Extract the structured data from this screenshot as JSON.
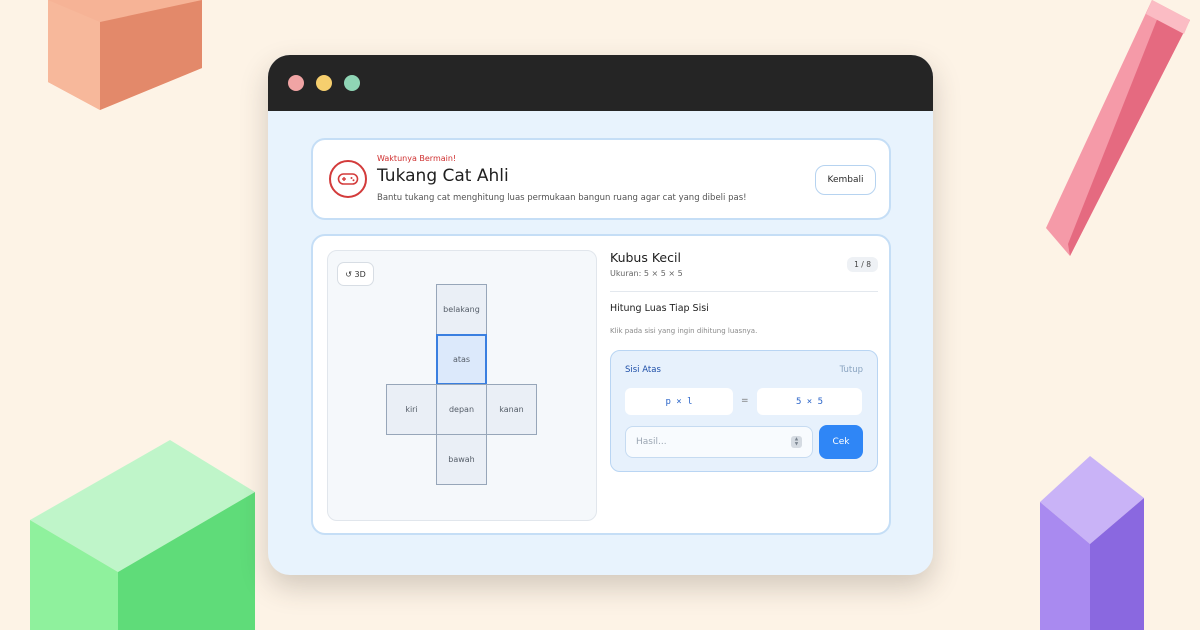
{
  "header": {
    "eyebrow": "Waktunya Bermain!",
    "title": "Tukang Cat Ahli",
    "subtitle": "Bantu tukang cat menghitung luas permukaan bangun ruang agar cat yang dibeli pas!",
    "back_label": "Kembali",
    "icon": "gamepad-icon"
  },
  "net": {
    "rotate_label": "3D",
    "rotate_icon": "rotate-icon",
    "faces": {
      "back": "belakang",
      "top": "atas",
      "left": "kiri",
      "front": "depan",
      "right": "kanan",
      "bottom": "bawah"
    },
    "selected_face": "atas"
  },
  "shape": {
    "title": "Kubus Kecil",
    "size": "Ukuran: 5 × 5 × 5",
    "progress": "1 / 8"
  },
  "task": {
    "title": "Hitung Luas Tiap Sisi",
    "hint": "Klik pada sisi yang ingin dihitung luasnya."
  },
  "calc": {
    "face_label": "Sisi Atas",
    "close_label": "Tutup",
    "formula_left": "p × l",
    "equals": "=",
    "formula_right": "5 × 5",
    "result_placeholder": "Hasil...",
    "submit_label": "Cek"
  },
  "colors": {
    "background": "#fdf3e6",
    "accent": "#2f86f6",
    "brand_red": "#d33b3b",
    "titlebar": "#252525"
  }
}
